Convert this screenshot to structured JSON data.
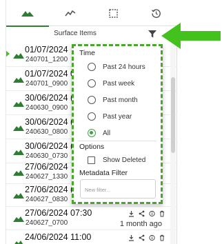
{
  "tabs": [
    {
      "icon": "mountain-icon",
      "active": true
    },
    {
      "icon": "trend-line-icon",
      "active": false
    },
    {
      "icon": "select-box-icon",
      "active": false
    },
    {
      "icon": "history-icon",
      "active": false
    }
  ],
  "header": {
    "title": "Surface Items",
    "filter_icon": "filter-icon"
  },
  "items": [
    {
      "date": "01/07/2024",
      "name": "240701_1200"
    },
    {
      "date": "01/07/2024 0",
      "name": "240701_0900"
    },
    {
      "date": "30/06/2024 (",
      "name": "240630_0900"
    },
    {
      "date": "30/06/2024 (",
      "name": "240630_0800"
    },
    {
      "date": "30/06/2024 (",
      "name": "240630_0730"
    },
    {
      "date": "27/06/2024",
      "name": "240627_1330"
    },
    {
      "date": "27/06/2024 (",
      "name": "240627_0830"
    },
    {
      "date": "27/06/2024 07:30",
      "name": "240627_0700",
      "ago": "1 month ago"
    },
    {
      "date": "24/06/2024 11:00",
      "name": ""
    }
  ],
  "filter_popup": {
    "time_label": "Time",
    "time_options": [
      {
        "label": "Past 24 hours",
        "checked": false
      },
      {
        "label": "Past week",
        "checked": false
      },
      {
        "label": "Past month",
        "checked": false
      },
      {
        "label": "Past year",
        "checked": false
      },
      {
        "label": "All",
        "checked": true
      }
    ],
    "options_label": "Options",
    "show_deleted_label": "Show Deleted",
    "show_deleted_checked": false,
    "metadata_label": "Metadata Filter",
    "metadata_placeholder": "New filter..."
  },
  "colors": {
    "accent": "#2e7d32",
    "highlight": "#4aa52d",
    "arrow": "#43c11d"
  }
}
